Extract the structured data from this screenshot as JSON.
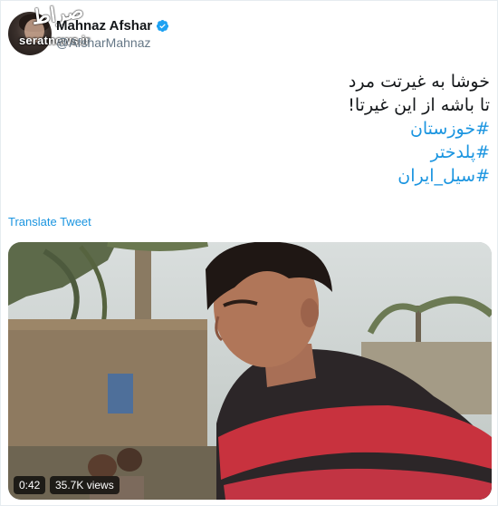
{
  "author": {
    "display_name": "Mahnaz Afshar",
    "handle": "@AfsharMahnaz",
    "verified": true,
    "avatar": "avatar-photo"
  },
  "watermark": {
    "script": "ﺻﺮﺍﻁ",
    "text": "seratnews.ir"
  },
  "tweet": {
    "lines": [
      "خوشا به غیرتت مرد",
      "تا باشه از این غیرتا!"
    ],
    "hashtags": [
      "#خوزستان",
      "#پلدختر",
      "#سیل_ایران"
    ]
  },
  "translate_link": "Translate Tweet",
  "video": {
    "duration": "0:42",
    "views": "35.7K views"
  },
  "colors": {
    "link": "#1b95e0",
    "text": "#14171a",
    "secondary": "#657786",
    "shirt_red": "#c8323e"
  }
}
